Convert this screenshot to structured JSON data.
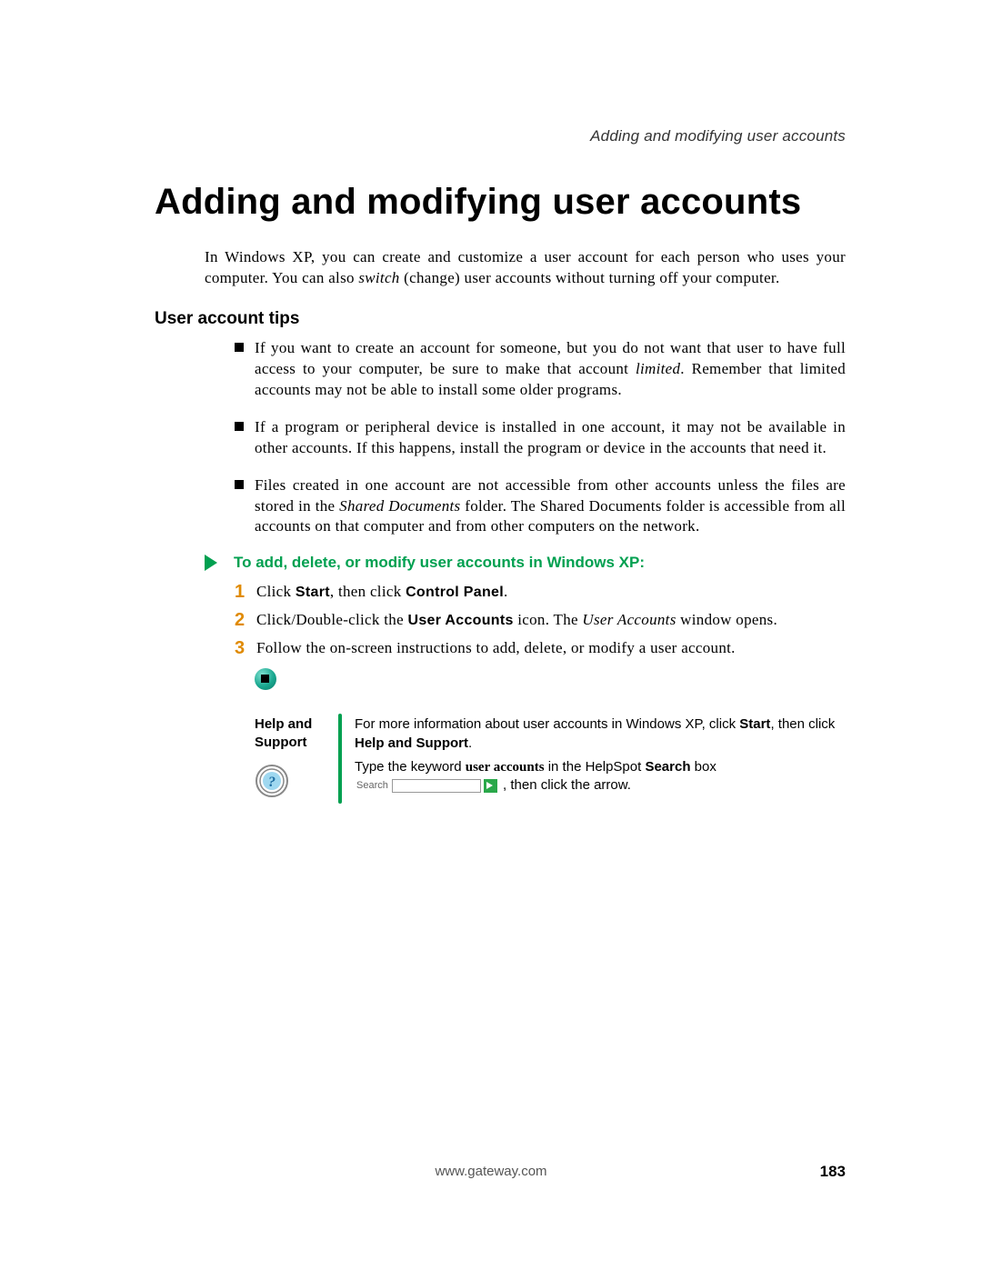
{
  "running_head": "Adding and modifying user accounts",
  "title": "Adding and modifying user accounts",
  "intro": {
    "pre": "In Windows XP, you can create and customize a user account for each person who uses your computer. You can also ",
    "em": "switch",
    "post": " (change) user accounts without turning off your computer."
  },
  "subhead": "User account tips",
  "tips": [
    {
      "pre": "If you want to create an account for someone, but you do not want that user to have full access to your computer, be sure to make that account ",
      "em": "limited",
      "post": ". Remember that limited accounts may not be able to install some older programs."
    },
    {
      "pre": "If a program or peripheral device is installed in one account, it may not be available in other accounts. If this happens, install the program or device in the accounts that need it.",
      "em": "",
      "post": ""
    },
    {
      "pre": "Files created in one account are not accessible from other accounts unless the files are stored in the ",
      "em": "Shared Documents",
      "post": " folder. The Shared Documents folder is accessible from all accounts on that computer and from other computers on the network."
    }
  ],
  "proc_head": "To add, delete, or modify user accounts in Windows XP:",
  "steps": {
    "s1": {
      "a": "Click ",
      "b": "Start",
      "c": ", then click ",
      "d": "Control Panel",
      "e": "."
    },
    "s2": {
      "a": "Click/Double-click the ",
      "b": "User Accounts",
      "c": " icon. The ",
      "d": "User Accounts",
      "e": " window opens."
    },
    "s3": {
      "a": "Follow the on-screen instructions to add, delete, or modify a user account."
    }
  },
  "help": {
    "label1": "Help and",
    "label2": "Support",
    "line1a": "For more information about user accounts in Windows XP, click ",
    "line1b": "Start",
    "line1c": ", then click ",
    "line1d": "Help and Support",
    "line1e": ".",
    "line2a": "Type the keyword ",
    "line2b": "user accounts",
    "line2c": " in the HelpSpot ",
    "line2d": "Search",
    "line2e": " box ",
    "search_label": "Search",
    "line2f": " , then click the arrow."
  },
  "footer_url": "www.gateway.com",
  "page_number": "183"
}
